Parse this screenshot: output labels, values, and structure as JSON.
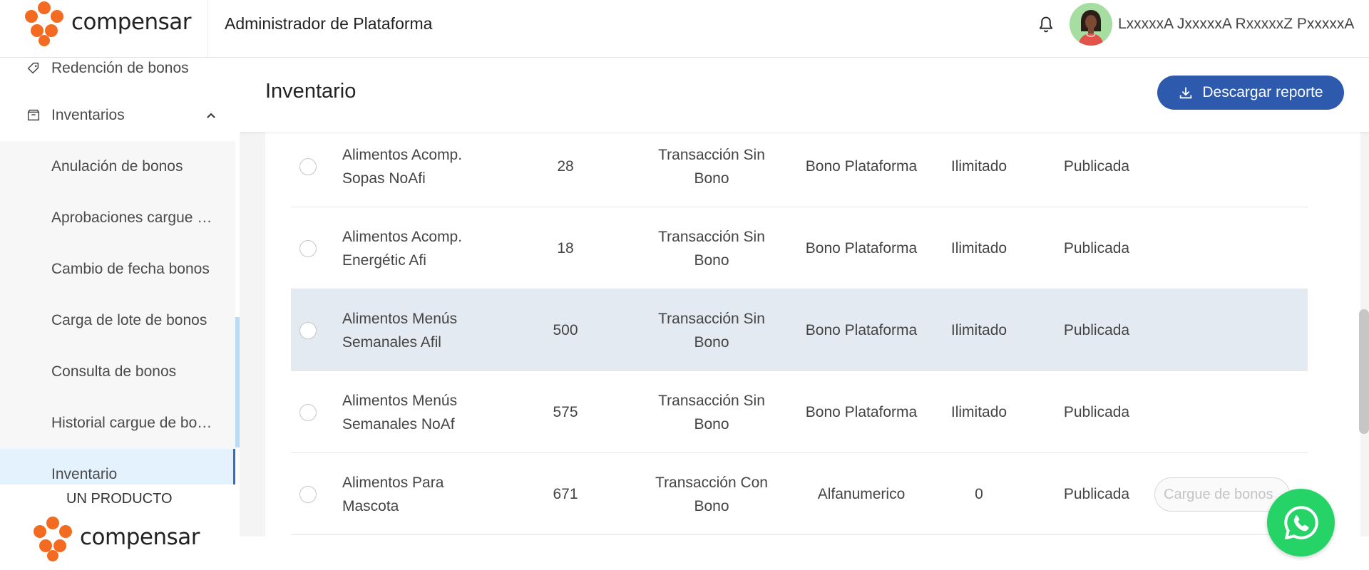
{
  "header": {
    "logo_text": "compensar",
    "title": "Administrador de Plataforma",
    "user_name": "LxxxxxA JxxxxxA RxxxxxZ PxxxxxA"
  },
  "sidebar": {
    "items": [
      {
        "label": "Redención de bonos",
        "icon": "tag-icon"
      },
      {
        "label": "Inventarios",
        "icon": "box-icon"
      }
    ],
    "sub_items": [
      {
        "label": "Anulación de bonos"
      },
      {
        "label": "Aprobaciones cargue de bonos"
      },
      {
        "label": "Cambio de fecha bonos"
      },
      {
        "label": "Carga de lote de bonos"
      },
      {
        "label": "Consulta de bonos"
      },
      {
        "label": "Historial cargue de bonos"
      },
      {
        "label": "Inventario"
      }
    ],
    "footer_text": "UN PRODUCTO",
    "footer_logo_text": "compensar"
  },
  "page": {
    "title": "Inventario",
    "download_label": "Descargar reporte"
  },
  "table": {
    "rows": [
      {
        "name": "Alimentos Acomp. Sopas NoAfi",
        "qty": "28",
        "type": "Transacción Sin Bono",
        "bono": "Bono Plataforma",
        "limit": "Ilimitado",
        "state": "Publicada",
        "action": ""
      },
      {
        "name": "Alimentos Acomp. Energétic Afi",
        "qty": "18",
        "type": "Transacción Sin Bono",
        "bono": "Bono Plataforma",
        "limit": "Ilimitado",
        "state": "Publicada",
        "action": ""
      },
      {
        "name": "Alimentos Menús Semanales Afil",
        "qty": "500",
        "type": "Transacción Sin Bono",
        "bono": "Bono Plataforma",
        "limit": "Ilimitado",
        "state": "Publicada",
        "action": ""
      },
      {
        "name": "Alimentos Menús Semanales NoAf",
        "qty": "575",
        "type": "Transacción Sin Bono",
        "bono": "Bono Plataforma",
        "limit": "Ilimitado",
        "state": "Publicada",
        "action": ""
      },
      {
        "name": "Alimentos Para Mascota",
        "qty": "671",
        "type": "Transacción Con Bono",
        "bono": "Alfanumerico",
        "limit": "0",
        "state": "Publicada",
        "action": "Cargue de bonos"
      }
    ]
  },
  "colors": {
    "brand_orange": "#f26b21",
    "primary_blue": "#2e5aad",
    "highlight_row": "#e3eaf2",
    "active_sidebar": "#e3f2fc",
    "whatsapp_green": "#25d366"
  }
}
